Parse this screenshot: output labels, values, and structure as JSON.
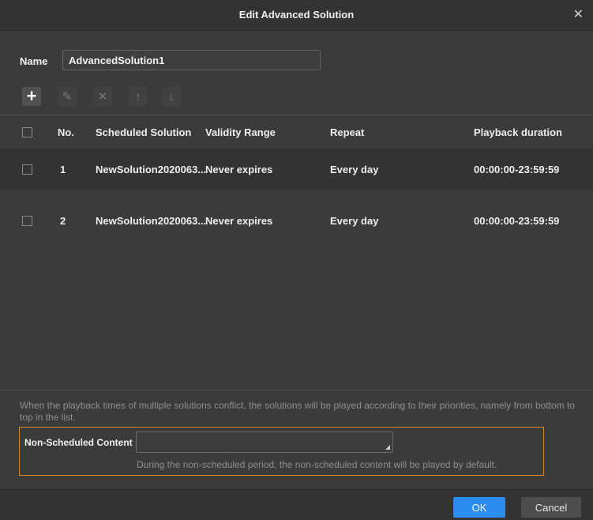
{
  "dialog": {
    "title": "Edit Advanced Solution",
    "close_glyph": "✕"
  },
  "name_field": {
    "label": "Name",
    "value": "AdvancedSolution1"
  },
  "toolbar": {
    "add_glyph": "+",
    "edit_glyph": "✎",
    "delete_glyph": "✕",
    "up_glyph": "↑",
    "down_glyph": "↓"
  },
  "table": {
    "columns": [
      "No.",
      "Scheduled Solution",
      "Validity Range",
      "Repeat",
      "Playback duration"
    ],
    "rows": [
      {
        "no": "1",
        "solution": "NewSolution2020063...",
        "validity": "Never expires",
        "repeat": "Every day",
        "duration": "00:00:00-23:59:59"
      },
      {
        "no": "2",
        "solution": "NewSolution2020063...",
        "validity": "Never expires",
        "repeat": "Every day",
        "duration": "00:00:00-23:59:59"
      }
    ]
  },
  "hint": "When the playback times of multiple solutions conflict, the solutions will be played according to their priorities, namely from bottom to top in the list.",
  "non_scheduled": {
    "label": "Non-Scheduled Content",
    "value": "",
    "note": "During the non-scheduled period, the non-scheduled content will be played by default."
  },
  "footer": {
    "ok_label": "OK",
    "cancel_label": "Cancel"
  },
  "colors": {
    "accent": "#2d8cf0",
    "highlight_border": "#d98a2b"
  }
}
